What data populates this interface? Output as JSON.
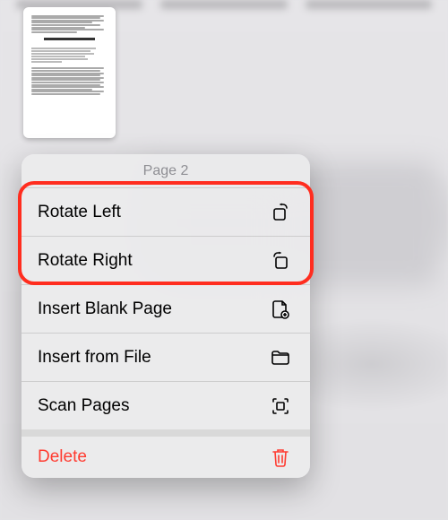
{
  "thumbnail": {
    "page_label": "Document page thumbnail"
  },
  "menu": {
    "header": "Page 2",
    "items": {
      "rotate_left": {
        "label": "Rotate Left"
      },
      "rotate_right": {
        "label": "Rotate Right"
      },
      "insert_blank": {
        "label": "Insert Blank Page"
      },
      "insert_file": {
        "label": "Insert from File"
      },
      "scan": {
        "label": "Scan Pages"
      },
      "delete": {
        "label": "Delete"
      }
    }
  },
  "highlight": {
    "targets": [
      "rotate_left",
      "rotate_right"
    ]
  },
  "colors": {
    "danger": "#ff3b30",
    "highlight": "#ff2d1f",
    "header_text": "#8e8e93"
  }
}
